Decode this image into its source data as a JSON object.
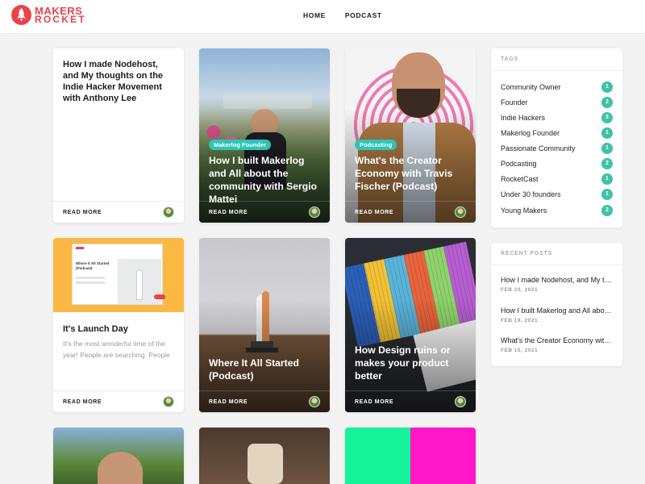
{
  "brand": {
    "line1": "MAKERS",
    "line2": "ROCKET",
    "color": "#e8434a"
  },
  "nav": [
    {
      "label": "HOME"
    },
    {
      "label": "PODCAST"
    }
  ],
  "posts": [
    {
      "title": "How I made Nodehost, and My thoughts on the Indie Hacker Movement with Anthony Lee",
      "tag": "",
      "excerpt": "",
      "read_more": "READ MORE"
    },
    {
      "title": "How I built Makerlog and All about the community with Sergio Mattei",
      "tag": "Makerlog Founder",
      "excerpt": "",
      "read_more": "READ MORE"
    },
    {
      "title": "What's the Creator Economy with Travis Fischer (Podcast)",
      "tag": "Podcasting",
      "excerpt": "",
      "read_more": "READ MORE"
    },
    {
      "title": "It's Launch Day",
      "tag": "",
      "excerpt": "It's the most wonderful time of the year! People are searching. People",
      "read_more": "READ MORE"
    },
    {
      "title": "Where It All Started (Podcast)",
      "tag": "",
      "excerpt": "",
      "read_more": "READ MORE"
    },
    {
      "title": "How Design ruins or makes your product better",
      "tag": "",
      "excerpt": "",
      "read_more": "READ MORE"
    }
  ],
  "launch_thumb": {
    "heading": "Where It All Started (Podcast)"
  },
  "tags_widget": {
    "title": "TAGS",
    "items": [
      {
        "name": "Community Owner",
        "count": "1"
      },
      {
        "name": "Founder",
        "count": "2"
      },
      {
        "name": "Indie Hackers",
        "count": "3"
      },
      {
        "name": "Makerlog Founder",
        "count": "1"
      },
      {
        "name": "Passionate Community",
        "count": "1"
      },
      {
        "name": "Podcasting",
        "count": "2"
      },
      {
        "name": "RocketCast",
        "count": "1"
      },
      {
        "name": "Under 30 founders",
        "count": "1"
      },
      {
        "name": "Young Makers",
        "count": "2"
      }
    ]
  },
  "recent_widget": {
    "title": "RECENT POSTS",
    "items": [
      {
        "title": "How I made Nodehost, and My thoughts on the Indie Hacker Movement with Anthony Lee",
        "date": "FEB 20, 2021"
      },
      {
        "title": "How I built Makerlog and All about the community with Sergio Mattei",
        "date": "FEB 19, 2021"
      },
      {
        "title": "What's the Creator Economy with Travis Fischer (Podcast)",
        "date": "FEB 15, 2021"
      }
    ]
  },
  "colors": {
    "accent_teal": "#2ec4b6",
    "count_badge": "#3fc2a7"
  }
}
